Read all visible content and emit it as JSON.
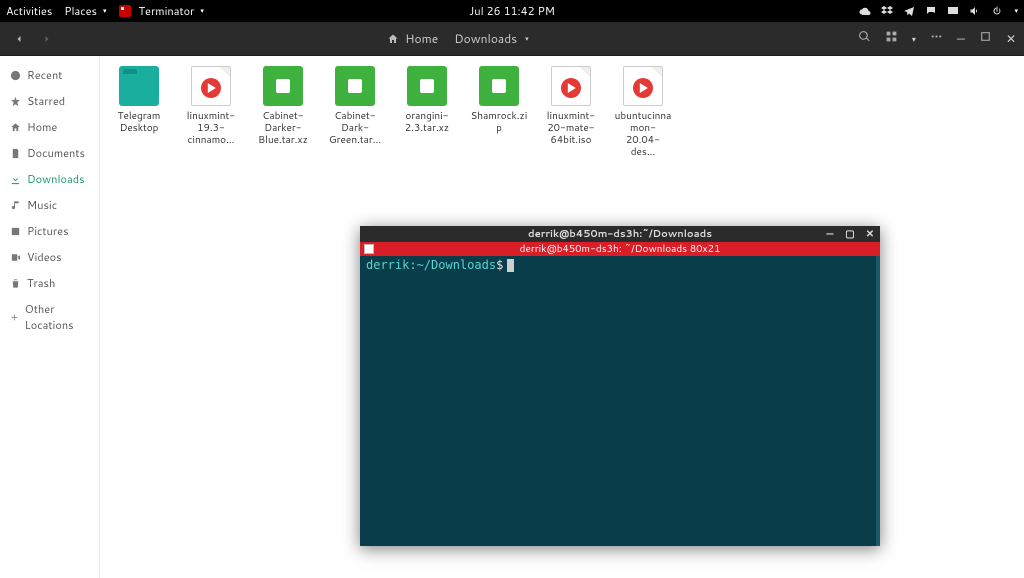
{
  "panel": {
    "activities": "Activities",
    "places": "Places",
    "app": "Terminator",
    "clock": "Jul 26  11:42 PM"
  },
  "fm": {
    "path": {
      "home": "Home",
      "downloads": "Downloads"
    },
    "sidebar": [
      {
        "label": "Recent"
      },
      {
        "label": "Starred"
      },
      {
        "label": "Home"
      },
      {
        "label": "Documents"
      },
      {
        "label": "Downloads",
        "active": true
      },
      {
        "label": "Music"
      },
      {
        "label": "Pictures"
      },
      {
        "label": "Videos"
      },
      {
        "label": "Trash"
      },
      {
        "label": "Other Locations"
      }
    ],
    "files": [
      {
        "label": "Telegram Desktop",
        "type": "folder"
      },
      {
        "label": "linuxmint-19.3-cinnamo...",
        "type": "iso"
      },
      {
        "label": "Cabinet-Darker-Blue.tar.xz",
        "type": "archive"
      },
      {
        "label": "Cabinet-Dark-Green.tar...",
        "type": "archive"
      },
      {
        "label": "orangini-2.3.tar.xz",
        "type": "archive"
      },
      {
        "label": "Shamrock.zip",
        "type": "archive"
      },
      {
        "label": "linuxmint-20-mate-64bit.iso",
        "type": "iso"
      },
      {
        "label": "ubuntucinnamon-20.04-des...",
        "type": "iso"
      }
    ]
  },
  "terminal": {
    "title": "derrik@b450m-ds3h:~/Downloads",
    "tab": "derrik@b450m-ds3h: ~/Downloads 80x21",
    "prompt_user": "derrik:",
    "prompt_path": "~/Downloads",
    "prompt_dollar": "$"
  }
}
